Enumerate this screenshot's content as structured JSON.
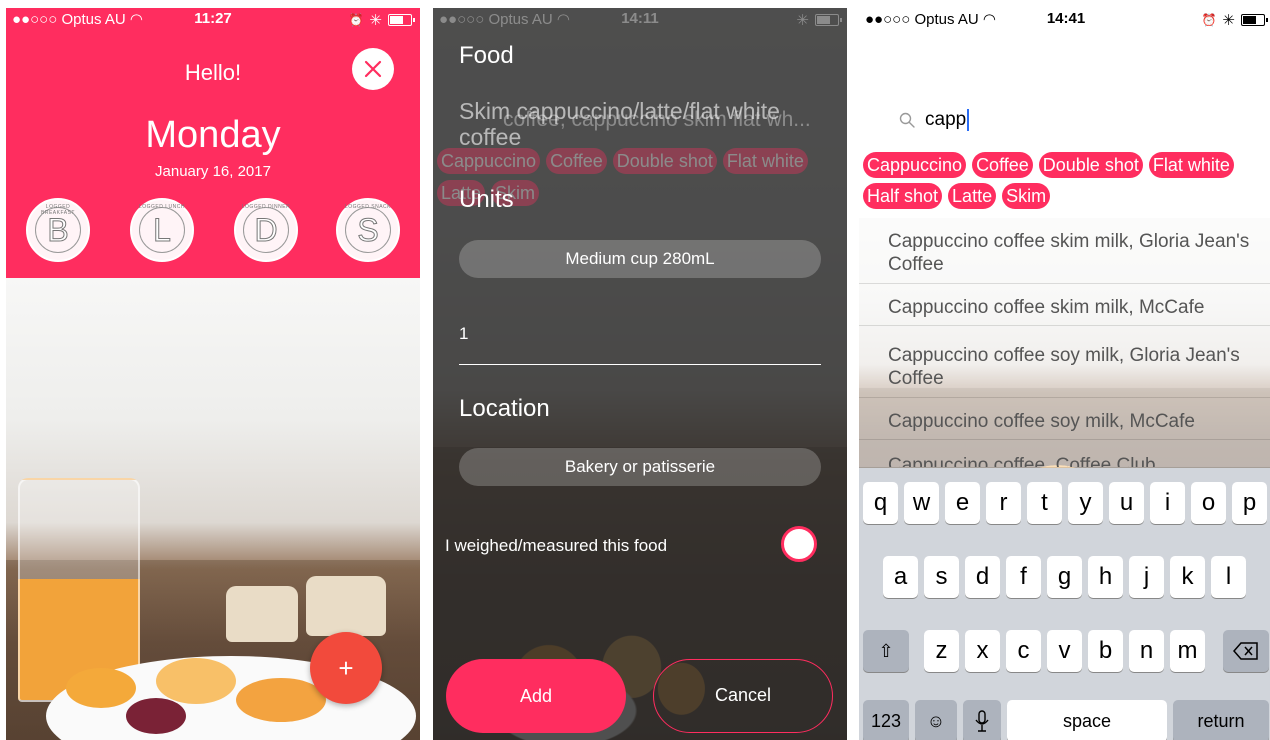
{
  "status": {
    "p1": {
      "carrier": "●●○○○ Optus AU",
      "time": "11:27"
    },
    "p2": {
      "carrier": "●●○○○ Optus AU",
      "time": "14:11"
    },
    "p3": {
      "carrier": "●●○○○ Optus AU",
      "time": "14:41"
    }
  },
  "p1": {
    "greeting": "Hello!",
    "day": "Monday",
    "date": "January 16, 2017",
    "meals": [
      {
        "letter": "B",
        "caption": "LOGGED BREAKFAST"
      },
      {
        "letter": "L",
        "caption": "LOGGED LUNCH"
      },
      {
        "letter": "D",
        "caption": "LOGGED DINNER"
      },
      {
        "letter": "S",
        "caption": "LOGGED SNACK"
      }
    ],
    "fab_label": "+",
    "accent": "#ff2d5f",
    "fab_color": "#f24a3c"
  },
  "p2": {
    "food_label": "Food",
    "food_value": "Skim cappuccino/latte/flat white coffee",
    "ghost_text": "coffee, cappuccino skim flat wh...",
    "ghost_chips": [
      "Cappuccino",
      "Coffee",
      "Double shot",
      "Flat white",
      "Latte",
      "Skim"
    ],
    "units_label": "Units",
    "unit_value": "Medium cup 280mL",
    "quantity": "1",
    "location_label": "Location",
    "location_value": "Bakery or patisserie",
    "weighed_label": "I weighed/measured this food",
    "add_label": "Add",
    "cancel_label": "Cancel"
  },
  "p3": {
    "search_query": "capp",
    "chips": [
      "Cappuccino",
      "Coffee",
      "Double shot",
      "Flat white",
      "Half shot",
      "Latte",
      "Skim"
    ],
    "results": [
      "Cappuccino coffee skim milk, Gloria Jean's Coffee",
      "Cappuccino coffee skim milk, McCafe",
      "Cappuccino coffee soy milk, Gloria Jean's Coffee",
      "Cappuccino coffee soy milk, McCafe",
      "Cappuccino coffee, Coffee Club"
    ],
    "keyboard": {
      "row1": [
        "q",
        "w",
        "e",
        "r",
        "t",
        "y",
        "u",
        "i",
        "o",
        "p"
      ],
      "row2": [
        "a",
        "s",
        "d",
        "f",
        "g",
        "h",
        "j",
        "k",
        "l"
      ],
      "row3": [
        "z",
        "x",
        "c",
        "v",
        "b",
        "n",
        "m"
      ],
      "numbers": "123",
      "space": "space",
      "return": "return"
    }
  }
}
